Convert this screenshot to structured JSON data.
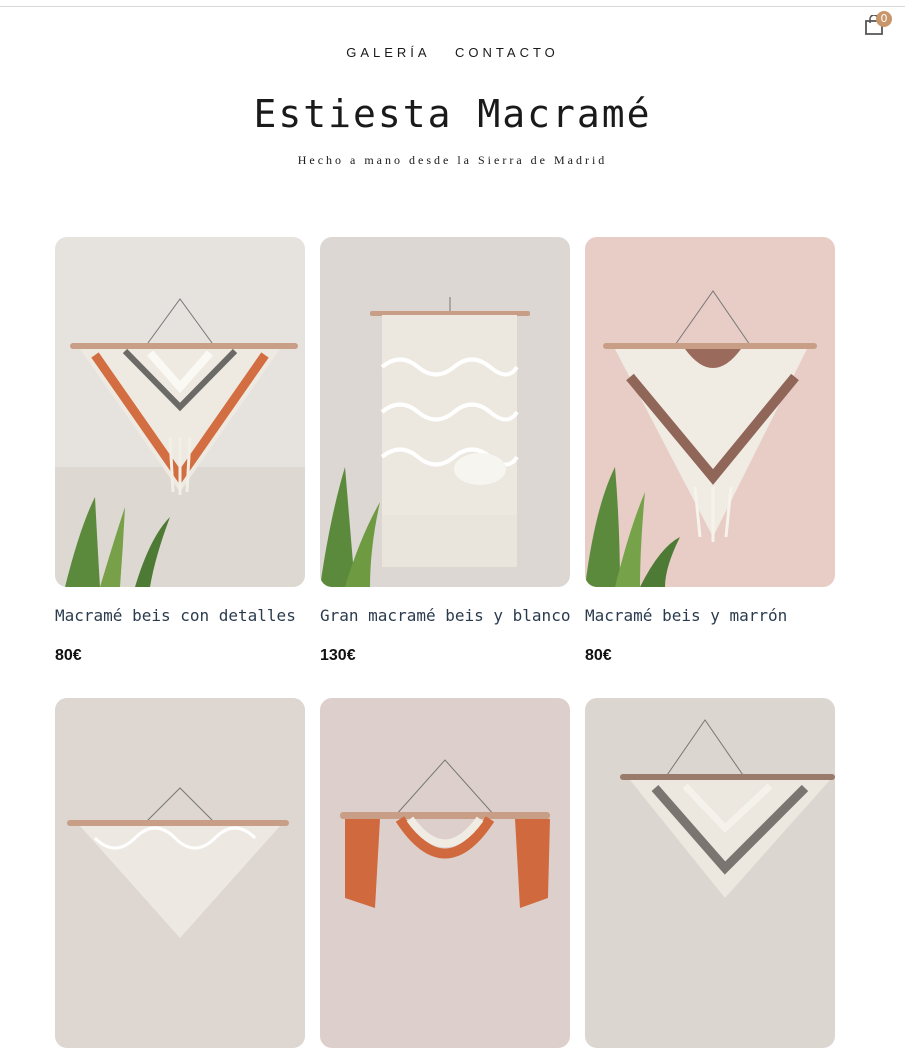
{
  "nav": {
    "items": [
      "GALERÍA",
      "CONTACTO"
    ]
  },
  "cart": {
    "count": "0",
    "icon": "shopping-bag-icon"
  },
  "header": {
    "title": "Estiesta Macramé",
    "subtitle": "Hecho a mano desde la Sierra de Madrid"
  },
  "colors": {
    "accent": "#c9966b",
    "product_name": "#2b3b4e"
  },
  "products": [
    {
      "name": "Macramé beis con detalles",
      "price": "80€"
    },
    {
      "name": "Gran macramé beis y blanco",
      "price": "130€"
    },
    {
      "name": "Macramé beis y marrón",
      "price": "80€"
    },
    {
      "name": "",
      "price": ""
    },
    {
      "name": "",
      "price": ""
    },
    {
      "name": "",
      "price": ""
    }
  ]
}
